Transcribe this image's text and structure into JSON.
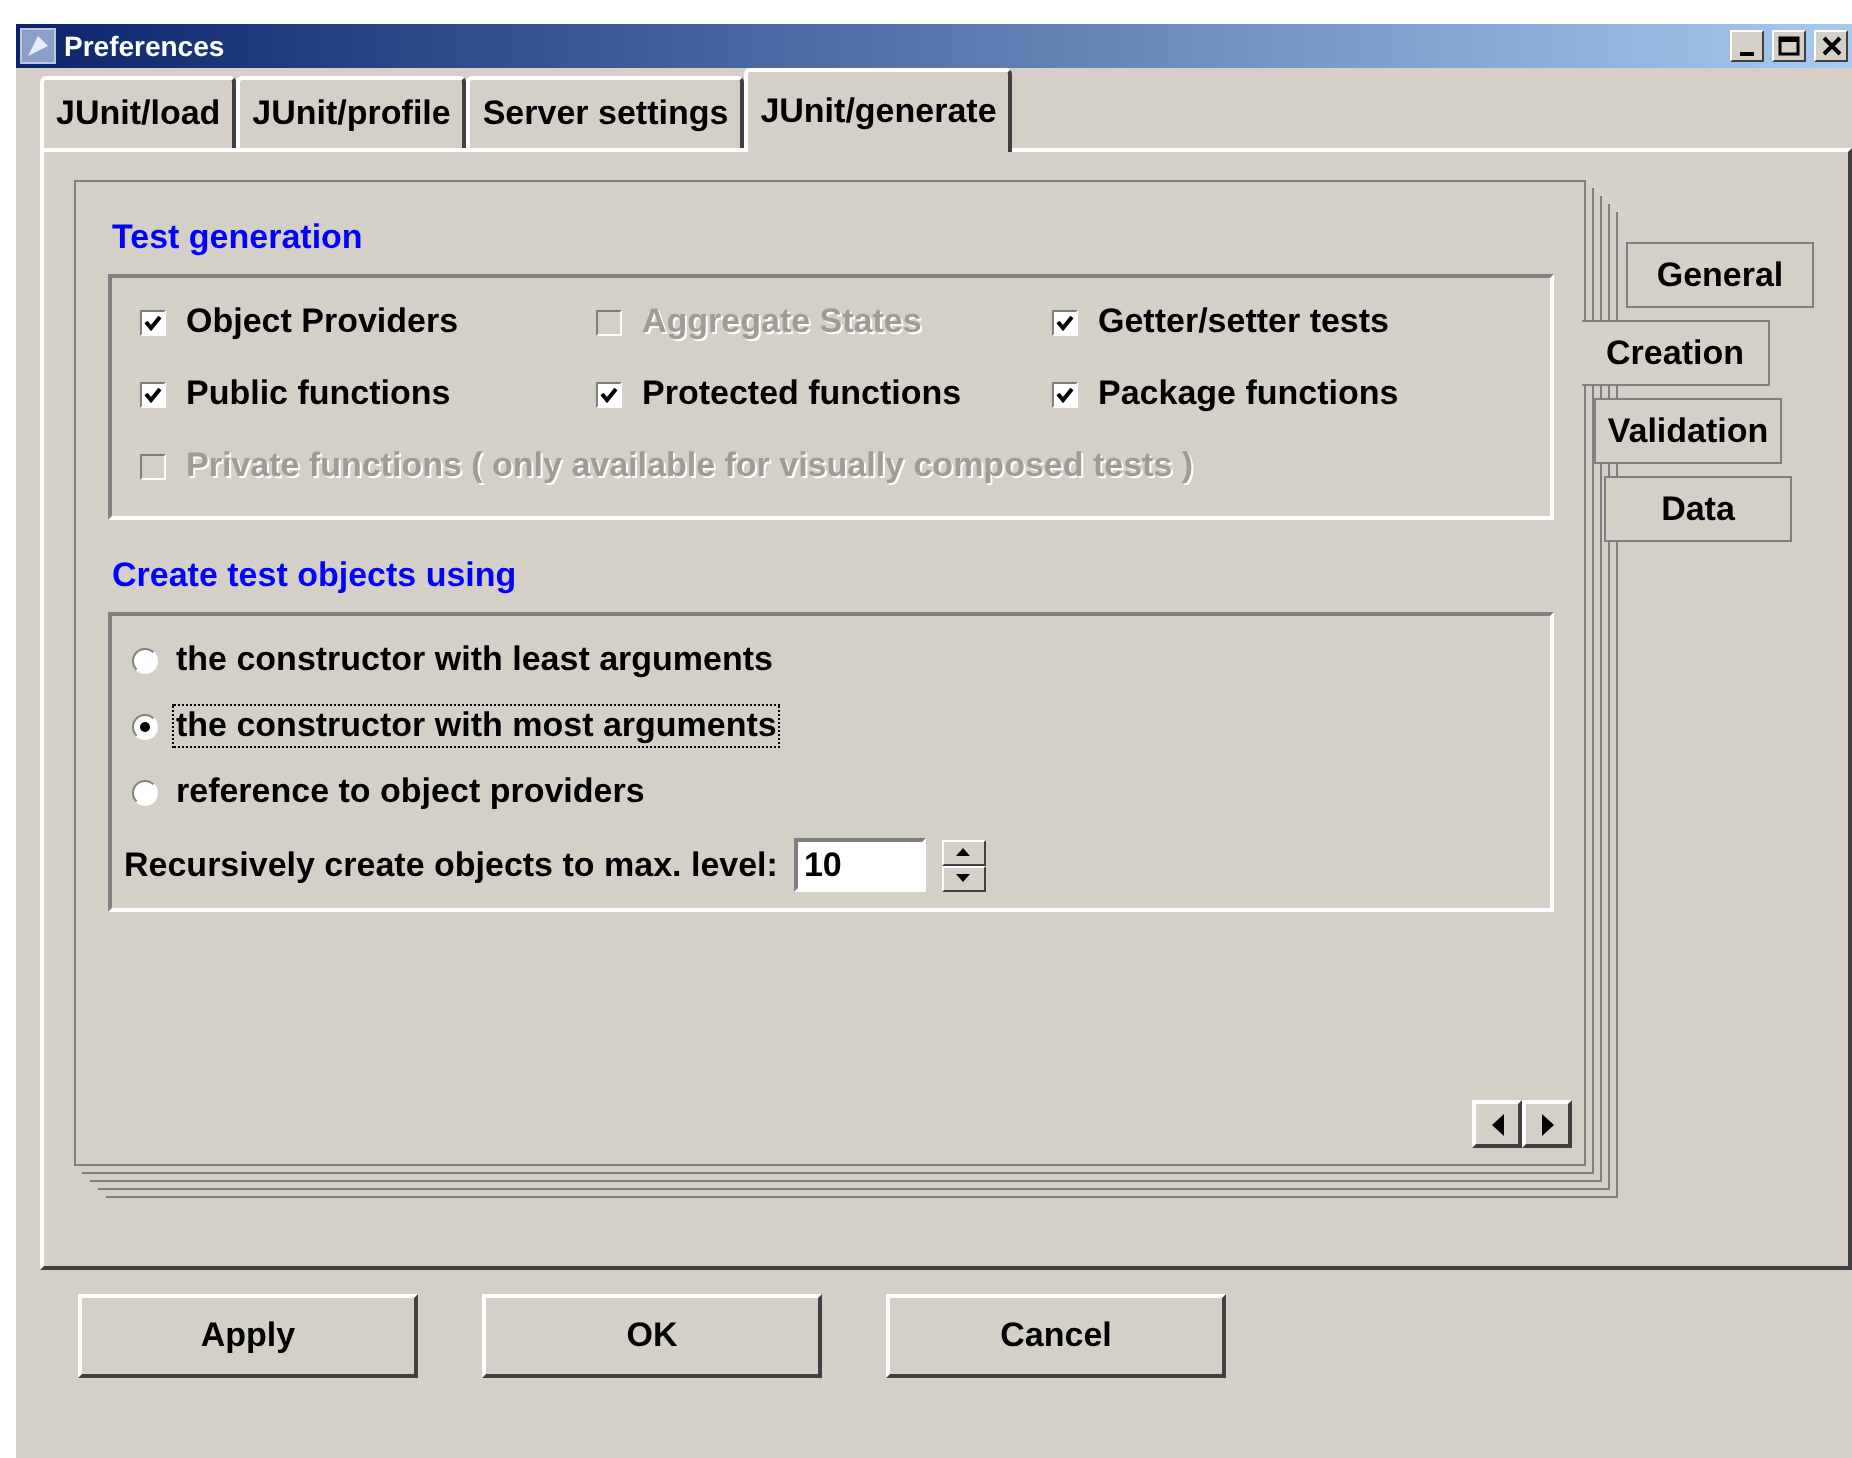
{
  "window": {
    "title": "Preferences"
  },
  "tabs": [
    {
      "label": "JUnit/load",
      "selected": false
    },
    {
      "label": "JUnit/profile",
      "selected": false
    },
    {
      "label": "Server settings",
      "selected": false
    },
    {
      "label": "JUnit/generate",
      "selected": true
    }
  ],
  "side_tabs": [
    {
      "label": "General",
      "selected": false
    },
    {
      "label": "Creation",
      "selected": true
    },
    {
      "label": "Validation",
      "selected": false
    },
    {
      "label": "Data",
      "selected": false
    }
  ],
  "test_generation": {
    "heading": "Test generation",
    "options": [
      {
        "label": "Object Providers",
        "checked": true,
        "disabled": false
      },
      {
        "label": "Aggregate States",
        "checked": false,
        "disabled": true
      },
      {
        "label": "Getter/setter tests",
        "checked": true,
        "disabled": false
      },
      {
        "label": "Public functions",
        "checked": true,
        "disabled": false
      },
      {
        "label": "Protected functions",
        "checked": true,
        "disabled": false
      },
      {
        "label": "Package functions",
        "checked": true,
        "disabled": false
      },
      {
        "label": "Private functions ( only available for visually composed tests )",
        "checked": false,
        "disabled": true
      }
    ]
  },
  "create_objects": {
    "heading": "Create test objects using",
    "options": [
      {
        "label": "the constructor with least arguments",
        "selected": false
      },
      {
        "label": "the constructor with most arguments",
        "selected": true
      },
      {
        "label": "reference to object providers",
        "selected": false
      }
    ],
    "max_level": {
      "label": "Recursively create objects to max. level:",
      "value": "10"
    }
  },
  "buttons": [
    "Apply",
    "OK",
    "Cancel"
  ]
}
